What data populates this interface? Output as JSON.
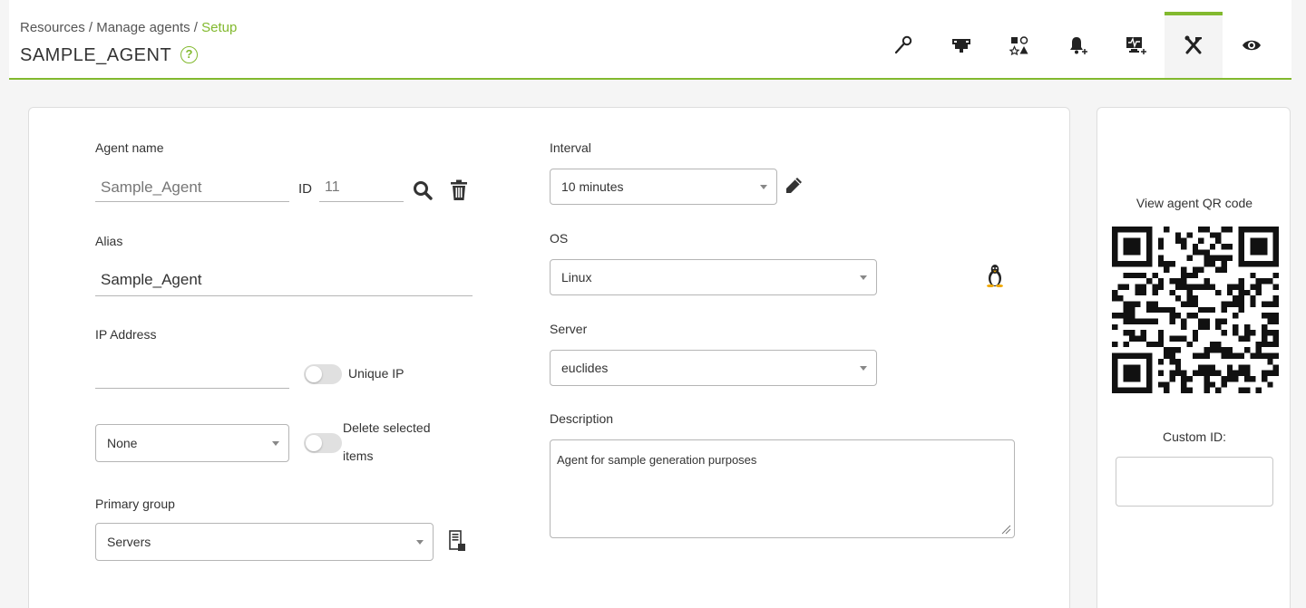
{
  "breadcrumb": {
    "part1": "Resources",
    "sep": " / ",
    "part2": "Manage agents",
    "current": "Setup"
  },
  "page": {
    "title": "SAMPLE_AGENT",
    "help_glyph": "?"
  },
  "tabs": [
    {
      "name": "tab-manage",
      "icon": "wrench-key-icon",
      "active": false
    },
    {
      "name": "tab-network",
      "icon": "network-icon",
      "active": false
    },
    {
      "name": "tab-modules",
      "icon": "modules-icon",
      "active": false
    },
    {
      "name": "tab-alerts",
      "icon": "bell-icon",
      "active": false
    },
    {
      "name": "tab-monitoring",
      "icon": "monitor-icon",
      "active": false
    },
    {
      "name": "tab-setup",
      "icon": "tools-icon",
      "active": true
    },
    {
      "name": "tab-view",
      "icon": "eye-icon",
      "active": false
    }
  ],
  "form": {
    "agent_name_label": "Agent name",
    "agent_name_value": "Sample_Agent",
    "id_label": "ID",
    "id_value": "11",
    "alias_label": "Alias",
    "alias_value": "Sample_Agent",
    "ip_label": "IP Address",
    "ip_value": "",
    "unique_ip_label": "Unique IP",
    "ip_select_value": "None",
    "delete_selected_line1": "Delete selected",
    "delete_selected_line2": "items",
    "primary_group_label": "Primary group",
    "primary_group_value": "Servers",
    "interval_label": "Interval",
    "interval_value": "10 minutes",
    "os_label": "OS",
    "os_value": "Linux",
    "server_label": "Server",
    "server_value": "euclides",
    "description_label": "Description",
    "description_value": "Agent for sample generation purposes"
  },
  "side": {
    "qr_label": "View agent QR code",
    "custom_id_label": "Custom ID:",
    "custom_id_value": ""
  },
  "colors": {
    "accent": "#82b92e",
    "text": "#333333",
    "border": "#b5b5b5"
  }
}
